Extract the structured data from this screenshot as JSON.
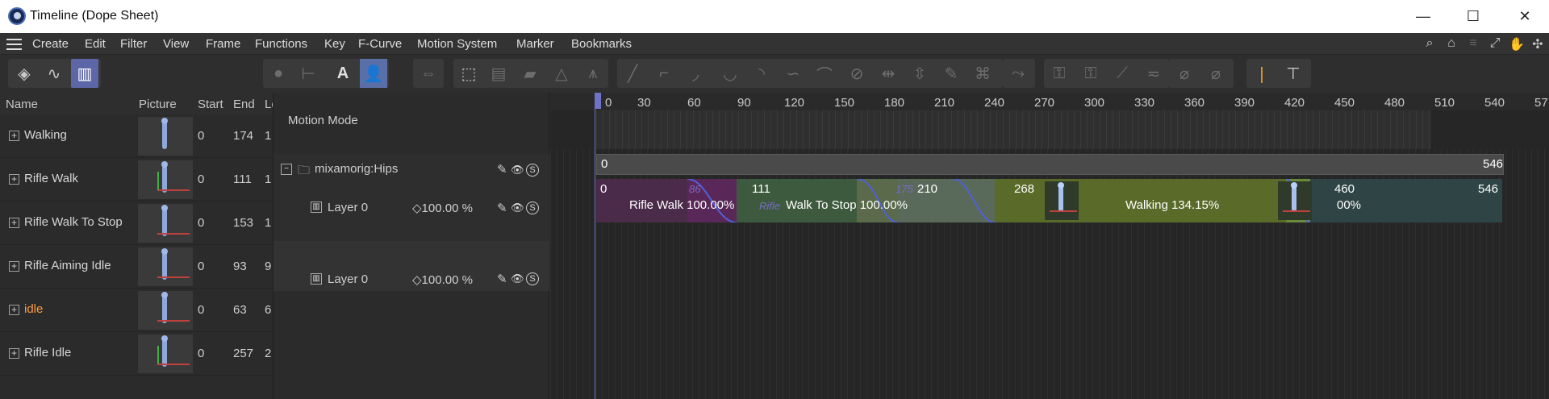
{
  "window": {
    "title": "Timeline (Dope Sheet)",
    "controls": {
      "minimize": "—",
      "maximize": "☐",
      "close": "✕"
    }
  },
  "menu": {
    "items": [
      "Create",
      "Edit",
      "Filter",
      "View",
      "Frame",
      "Functions",
      "Key",
      "F-Curve",
      "Motion System",
      "Marker",
      "Bookmarks"
    ]
  },
  "left_panel": {
    "columns": {
      "name": "Name",
      "picture": "Picture",
      "start": "Start",
      "end": "End",
      "length": "Le"
    },
    "rows": [
      {
        "name": "Walking",
        "start": "0",
        "end": "174",
        "len": "1"
      },
      {
        "name": "Rifle Walk",
        "start": "0",
        "end": "111",
        "len": "1"
      },
      {
        "name": "Rifle Walk To Stop",
        "start": "0",
        "end": "153",
        "len": "1"
      },
      {
        "name": "Rifle Aiming Idle",
        "start": "0",
        "end": "93",
        "len": "9"
      },
      {
        "name": "idle",
        "start": "0",
        "end": "63",
        "len": "6"
      },
      {
        "name": "Rifle Idle",
        "start": "0",
        "end": "257",
        "len": "2"
      }
    ]
  },
  "middle_panel": {
    "title": "Motion Mode",
    "hips_label": "mixamorig:Hips",
    "layers": [
      {
        "label": "Layer 0",
        "weight": "◇100.00 %"
      },
      {
        "label": "Layer 0",
        "weight": "◇100.00 %"
      }
    ],
    "icons": {
      "edit": "✎",
      "eye": "👁",
      "solo": "S"
    }
  },
  "timeline": {
    "ruler": [
      "0",
      "30",
      "60",
      "90",
      "120",
      "150",
      "180",
      "210",
      "240",
      "270",
      "300",
      "330",
      "360",
      "390",
      "420",
      "450",
      "480",
      "510",
      "540",
      "57"
    ],
    "hips_start": "0",
    "hips_end": "546",
    "layer_start": "0",
    "layer_end": "546",
    "clips": [
      {
        "label": "Rifle Walk   100.00%",
        "end": "111",
        "color": "#4a2b4a"
      },
      {
        "label": "Walk To Stop   100.00%",
        "end": "210",
        "color": "#3e5a3e"
      },
      {
        "label": "Walking   134.15%",
        "end": "460",
        "color": "#5a6a28"
      },
      {
        "label": "00%",
        "end": "546",
        "color": "#2f4a4a"
      }
    ],
    "transition_marks": [
      "268"
    ],
    "ghost_labels": {
      "rifle": "Rifle",
      "seventy_five": "175",
      "eighty_six": "86"
    }
  },
  "colors": {
    "accent": "#6f73c8",
    "highlight_text": "#ff9c3a",
    "active_tool": "#5d67a8"
  }
}
